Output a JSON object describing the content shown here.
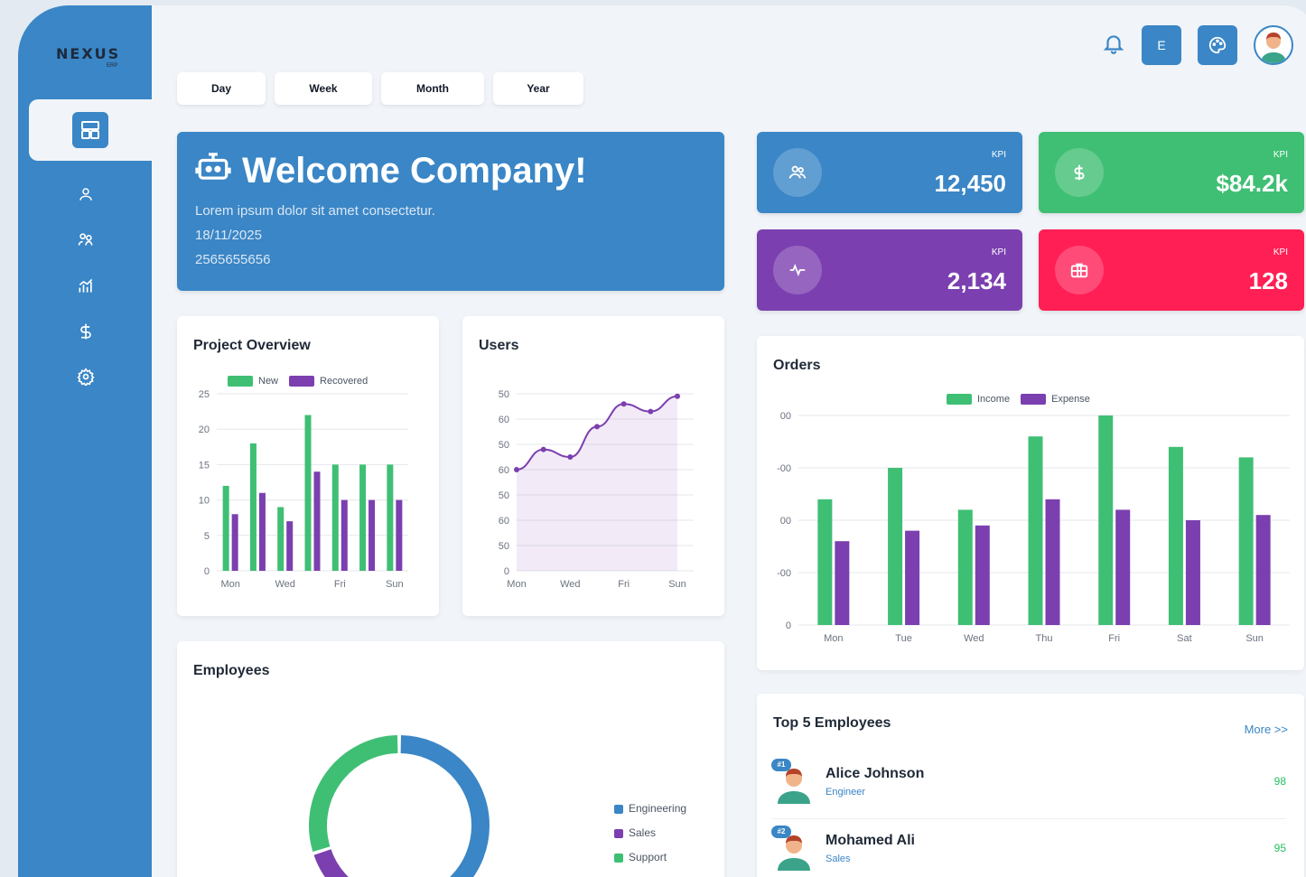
{
  "brand": {
    "name": "NEXUS",
    "sub": "ERP"
  },
  "filters": [
    "Day",
    "Week",
    "Month",
    "Year"
  ],
  "topbar": {
    "lang_label": "E"
  },
  "welcome": {
    "title": "Welcome Company!",
    "text": "Lorem ipsum dolor sit amet consectetur.",
    "date": "18/11/2025",
    "id": "2565655656"
  },
  "kpis": [
    {
      "label": "KPI",
      "value": "12,450",
      "icon": "users-icon",
      "color": "#3a86c6"
    },
    {
      "label": "KPI",
      "value": "$84.2k",
      "icon": "dollar-icon",
      "color": "#3fbf74"
    },
    {
      "label": "KPI",
      "value": "2,134",
      "icon": "activity-icon",
      "color": "#7b3fb0"
    },
    {
      "label": "KPI",
      "value": "128",
      "icon": "briefcase-icon",
      "color": "#ff1f55"
    }
  ],
  "colors": {
    "primary": "#3a86c6",
    "green": "#3fbf74",
    "purple": "#7b3fb0",
    "red": "#ff1f55"
  },
  "project": {
    "title": "Project Overview",
    "legend": [
      "New",
      "Recovered"
    ]
  },
  "users": {
    "title": "Users"
  },
  "orders": {
    "title": "Orders",
    "legend": [
      "Income",
      "Expense"
    ]
  },
  "employees": {
    "title": "Employees",
    "legend": [
      "Engineering",
      "Sales",
      "Support"
    ]
  },
  "top5": {
    "title": "Top 5 Employees",
    "more": "More >>",
    "items": [
      {
        "rank": "#1",
        "name": "Alice Johnson",
        "role": "Engineer",
        "score": "98"
      },
      {
        "rank": "#2",
        "name": "Mohamed Ali",
        "role": "Sales",
        "score": "95"
      }
    ]
  },
  "chart_data": [
    {
      "type": "bar",
      "title": "Project Overview",
      "categories": [
        "Mon",
        "Tue",
        "Wed",
        "Thu",
        "Fri",
        "Sat",
        "Sun"
      ],
      "x_tick_labels": [
        "Mon",
        "",
        "Wed",
        "",
        "Fri",
        "",
        "Sun"
      ],
      "yticks": [
        "0",
        "5",
        "10",
        "15",
        "20",
        "25"
      ],
      "ylim": [
        0,
        25
      ],
      "series": [
        {
          "name": "New",
          "values": [
            12,
            18,
            9,
            22,
            15,
            15,
            15
          ]
        },
        {
          "name": "Recovered",
          "values": [
            8,
            11,
            7,
            14,
            10,
            10,
            10
          ]
        }
      ]
    },
    {
      "type": "area",
      "title": "Users",
      "categories": [
        "Mon",
        "Tue",
        "Wed",
        "Thu",
        "Fri",
        "Sat",
        "Sun"
      ],
      "x_tick_labels": [
        "Mon",
        "",
        "Wed",
        "",
        "Fri",
        "",
        "Sun"
      ],
      "yticks": [
        "0",
        "50",
        "60",
        "50",
        "60",
        "50",
        "60",
        "50"
      ],
      "ylim": [
        0,
        7
      ],
      "values": [
        4.0,
        4.8,
        4.5,
        5.7,
        6.6,
        6.3,
        6.9
      ]
    },
    {
      "type": "bar",
      "title": "Orders",
      "categories": [
        "Mon",
        "Tue",
        "Wed",
        "Thu",
        "Fri",
        "Sat",
        "Sun"
      ],
      "yticks": [
        "0",
        "-00",
        "00",
        "-00",
        "00"
      ],
      "ylim": [
        0,
        4
      ],
      "series": [
        {
          "name": "Income",
          "values": [
            2.4,
            3.0,
            2.2,
            3.6,
            4.0,
            3.4,
            3.2
          ]
        },
        {
          "name": "Expense",
          "values": [
            1.6,
            1.8,
            1.9,
            2.4,
            2.2,
            2.0,
            2.1
          ]
        }
      ]
    },
    {
      "type": "pie",
      "title": "Employees",
      "categories": [
        "Engineering",
        "Sales",
        "Support"
      ],
      "values": [
        50,
        20,
        30
      ]
    }
  ]
}
